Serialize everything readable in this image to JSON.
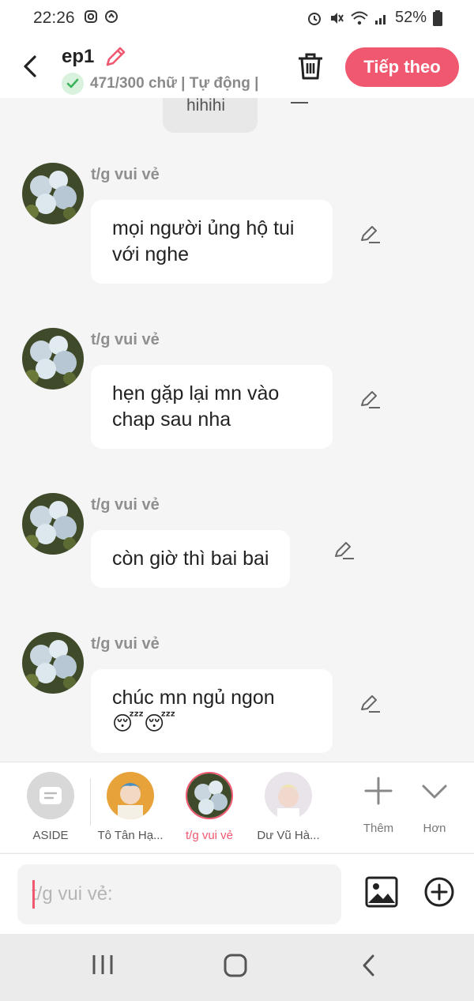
{
  "status_bar": {
    "time": "22:26",
    "battery": "52%"
  },
  "header": {
    "title": "ep1",
    "subtitle": "471/300 chữ | Tự động |",
    "next_label": "Tiếp theo"
  },
  "previous_message": {
    "text": "hihihi"
  },
  "messages": [
    {
      "author": "t/g vui vẻ",
      "text": "mọi người ủng hộ tui với nghe"
    },
    {
      "author": "t/g vui vẻ",
      "text": "hẹn gặp lại mn vào chap sau nha"
    },
    {
      "author": "t/g vui vẻ",
      "text": "còn giờ thì bai bai"
    },
    {
      "author": "t/g vui vẻ",
      "text": "chúc mn ngủ ngon 😴😴"
    }
  ],
  "characters": {
    "aside": "ASIDE",
    "items": [
      {
        "label": "Tô Tân Hạ..."
      },
      {
        "label": "t/g vui vẻ",
        "active": true
      },
      {
        "label": "Dư Vũ Hà..."
      }
    ],
    "add_label": "Thêm",
    "more_label": "Hơn"
  },
  "composer": {
    "placeholder": "t/g vui vẻ:"
  },
  "colors": {
    "accent": "#f05870",
    "check": "#3ab25a"
  },
  "icons": [
    "back-icon",
    "pencil-icon",
    "check-icon",
    "trash-icon",
    "aside-icon",
    "plus-icon",
    "chevron-down-icon",
    "image-icon",
    "add-circle-icon",
    "recent-apps-icon",
    "home-icon",
    "nav-back-icon"
  ]
}
